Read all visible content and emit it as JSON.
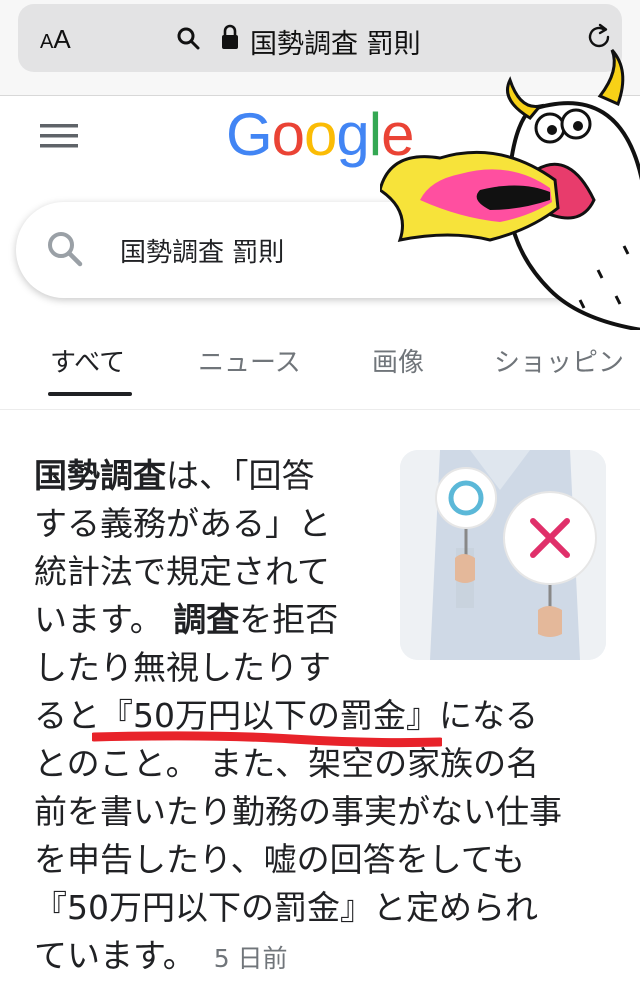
{
  "browser": {
    "text_size_label_small": "A",
    "text_size_label_large": "A",
    "url_text": "国勢調査 罰則"
  },
  "google": {
    "logo": [
      "G",
      "o",
      "o",
      "g",
      "l",
      "e"
    ],
    "search_query": "国勢調査 罰則",
    "tabs": [
      {
        "label": "すべて",
        "active": true
      },
      {
        "label": "ニュース",
        "active": false
      },
      {
        "label": "画像",
        "active": false
      },
      {
        "label": "ショッピン",
        "active": false
      }
    ]
  },
  "result": {
    "lines": [
      {
        "parts": [
          {
            "text": "国勢調査",
            "bold": true
          },
          {
            "text": "は、「回答"
          }
        ]
      },
      {
        "parts": [
          {
            "text": "する義務がある」と"
          }
        ]
      },
      {
        "parts": [
          {
            "text": "統計法で規定されて"
          }
        ]
      },
      {
        "parts": [
          {
            "text": "います。 "
          },
          {
            "text": "調査",
            "bold": true
          },
          {
            "text": "を拒否"
          }
        ]
      },
      {
        "parts": [
          {
            "text": "したり無視したりす"
          }
        ]
      },
      {
        "parts": [
          {
            "text": "ると『50万円以下の罰金』になる"
          }
        ]
      },
      {
        "parts": [
          {
            "text": "とのこと。 また、架空の家族の名"
          }
        ]
      },
      {
        "parts": [
          {
            "text": "前を書いたり勤務の事実がない仕事"
          }
        ]
      },
      {
        "parts": [
          {
            "text": "を申告したり、嘘の回答をしても"
          }
        ]
      },
      {
        "parts": [
          {
            "text": "『50万円以下の罰金』と定められ"
          }
        ]
      },
      {
        "parts": [
          {
            "text": "ています。"
          }
        ]
      }
    ],
    "timestamp": "5 日前"
  },
  "colors": {
    "google_blue": "#4285f4",
    "google_red": "#ea4335",
    "google_yellow": "#fbbc05",
    "google_green": "#34a853",
    "annotation_red": "#e8232a"
  }
}
